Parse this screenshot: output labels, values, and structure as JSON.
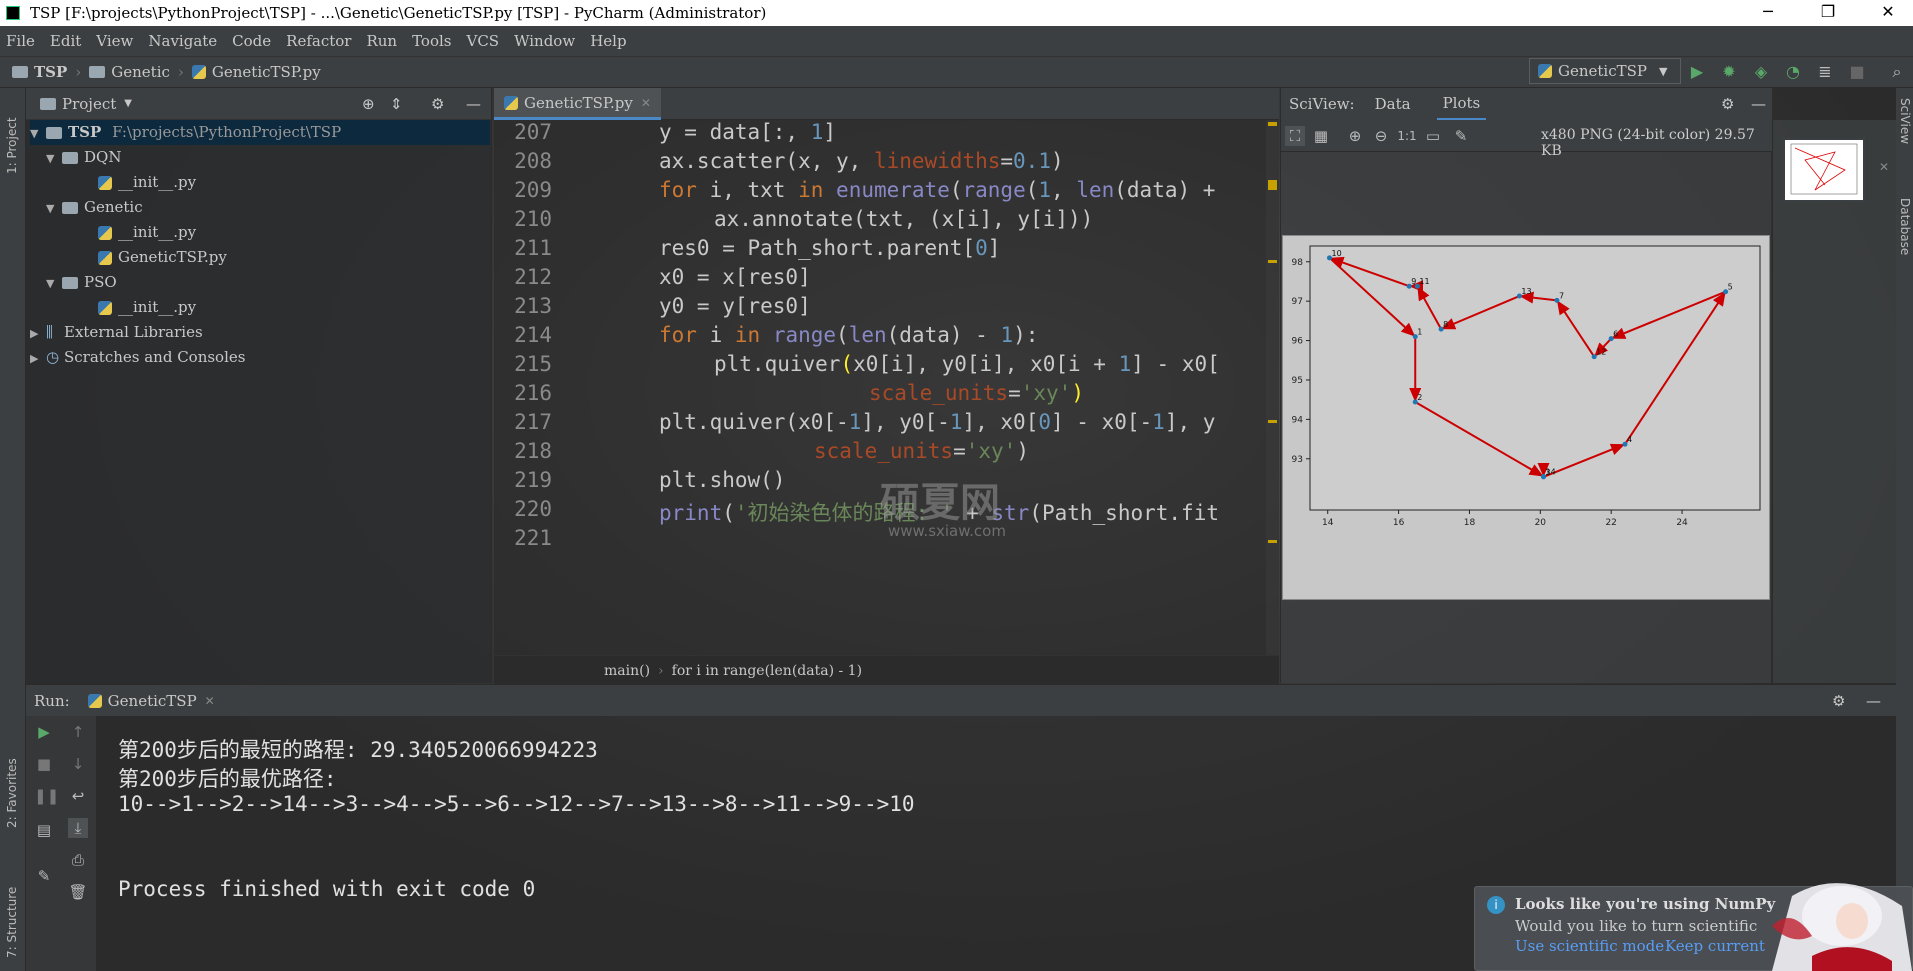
{
  "window": {
    "title": "TSP [F:\\projects\\PythonProject\\TSP] - ...\\Genetic\\GeneticTSP.py [TSP] - PyCharm (Administrator)",
    "minimize": "─",
    "maximize": "❐",
    "close": "✕"
  },
  "menu": [
    "File",
    "Edit",
    "View",
    "Navigate",
    "Code",
    "Refactor",
    "Run",
    "Tools",
    "VCS",
    "Window",
    "Help"
  ],
  "nav": {
    "crumb1": "TSP",
    "crumb2": "Genetic",
    "crumb3": "GeneticTSP.py",
    "run_config": "GeneticTSP"
  },
  "left_strip": {
    "project": "1: Project",
    "favorites": "2: Favorites",
    "structure": "7: Structure"
  },
  "project": {
    "header": "Project",
    "root_name": "TSP",
    "root_path": "F:\\projects\\PythonProject\\TSP",
    "items": [
      "DQN",
      "__init__.py",
      "Genetic",
      "__init__.py",
      "GeneticTSP.py",
      "PSO",
      "__init__.py",
      "External Libraries",
      "Scratches and Consoles"
    ]
  },
  "editor": {
    "tab": "GeneticTSP.py",
    "breadcrumb1": "main()",
    "breadcrumb2": "for i in range(len(data) - 1)"
  },
  "sciview": {
    "title": "SciView:",
    "tab_data": "Data",
    "tab_plots": "Plots",
    "image_info": "x480 PNG (24-bit color) 29.57 KB",
    "one_to_one": "1:1"
  },
  "right_strip": {
    "sciview": "SciView",
    "database": "Database"
  },
  "run": {
    "label": "Run:",
    "tab": "GeneticTSP",
    "output": [
      "第200步后的最短的路程: 29.340520066994223",
      "第200步后的最优路径:",
      "10-->1-->2-->14-->3-->4-->5-->6-->12-->7-->13-->8-->11-->9-->10",
      "",
      "Process finished with exit code 0"
    ]
  },
  "notification": {
    "title": "Looks like you're using NumPy",
    "body": "Would you like to turn scientific",
    "link1": "Use scientific mode",
    "link2": "Keep current"
  },
  "watermark": {
    "text": "硕夏网",
    "url": "www.sxiaw.com"
  },
  "chart_data": {
    "type": "scatter",
    "title": "",
    "xlabel": "",
    "ylabel": "",
    "xlim": [
      13.5,
      26.2
    ],
    "ylim": [
      91.7,
      98.4
    ],
    "xticks": [
      14,
      16,
      18,
      20,
      22,
      24
    ],
    "yticks": [
      93,
      94,
      95,
      96,
      97,
      98
    ],
    "points": [
      {
        "label": "10",
        "x": 14.05,
        "y": 98.1
      },
      {
        "label": "1",
        "x": 16.47,
        "y": 96.1
      },
      {
        "label": "2",
        "x": 16.47,
        "y": 94.44
      },
      {
        "label": "3",
        "x": 20.09,
        "y": 92.54
      },
      {
        "label": "4",
        "x": 22.39,
        "y": 93.37
      },
      {
        "label": "5",
        "x": 25.23,
        "y": 97.24
      },
      {
        "label": "6",
        "x": 22.0,
        "y": 96.05
      },
      {
        "label": "7",
        "x": 20.47,
        "y": 97.02
      },
      {
        "label": "8",
        "x": 17.2,
        "y": 96.29
      },
      {
        "label": "9",
        "x": 16.3,
        "y": 97.38
      },
      {
        "label": "11",
        "x": 16.53,
        "y": 97.38
      },
      {
        "label": "12",
        "x": 21.52,
        "y": 95.59
      },
      {
        "label": "13",
        "x": 19.41,
        "y": 97.13
      },
      {
        "label": "14",
        "x": 20.09,
        "y": 92.55
      }
    ],
    "path": [
      "10",
      "1",
      "2",
      "14",
      "3",
      "4",
      "5",
      "6",
      "12",
      "7",
      "13",
      "8",
      "11",
      "9",
      "10"
    ],
    "point_color": "#1f77b4",
    "arrow_color": "#cc0000"
  }
}
